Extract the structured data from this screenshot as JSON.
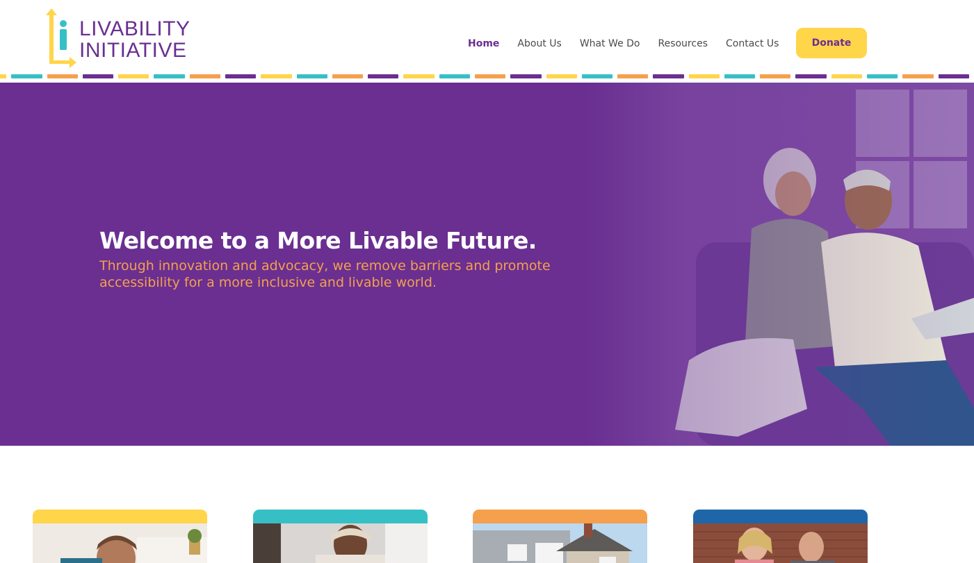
{
  "logo": {
    "line1": "LIVABILITY",
    "line2": "INITIATIVE",
    "colors": {
      "purple": "#6a2f91",
      "yellow": "#ffd54a",
      "teal": "#36c0c6"
    }
  },
  "nav": {
    "items": [
      "Home",
      "About Us",
      "What We Do",
      "Resources",
      "Contact Us"
    ],
    "active": "Home",
    "donate_label": "Donate"
  },
  "stripe_colors": [
    "#ffd54a",
    "#36c0c6",
    "#f5a04d",
    "#6a2f91"
  ],
  "hero": {
    "title": "Welcome to a More Livable Future.",
    "subtitle": "Through innovation and advocacy, we remove barriers and promote accessibility for a more inclusive and livable world.",
    "background": "#6a2f91",
    "subtitle_color": "#f5a04d",
    "photo": "older-couple-on-sofa-photo"
  },
  "cards": [
    {
      "accent": "#ffd54a",
      "photo": "man-writing-at-desk-photo"
    },
    {
      "accent": "#36c0c6",
      "photo": "woman-reading-photo"
    },
    {
      "accent": "#f5a04d",
      "photo": "house-exterior-photo"
    },
    {
      "accent": "#1f66a8",
      "photo": "people-outdoors-photo"
    }
  ]
}
